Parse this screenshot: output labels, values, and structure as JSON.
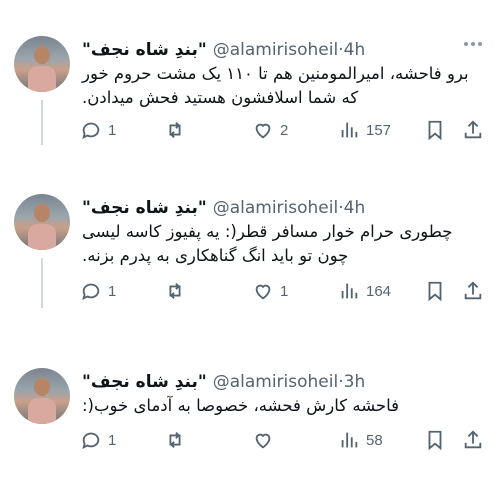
{
  "tweets": [
    {
      "display_name": "\"بندِ شاه نجف\"",
      "handle": "@alamirisoheil",
      "time": "4h",
      "lines": [
        "برو فاحشه، امیرالمومنین هم تا ۱۱۰ یک مشت حروم خور",
        "که شما اسلافشون هستید فحش میدادن."
      ],
      "replies": "1",
      "retweets": "",
      "likes": "2",
      "views": "157"
    },
    {
      "display_name": "\"بندِ شاه نجف\"",
      "handle": "@alamirisoheil",
      "time": "4h",
      "lines": [
        "چطوری حرام خوار مسافر قطر(: یه پفیوز کاسه لیسی",
        "چون تو باید انگ گناهکاری به پدرم بزنه."
      ],
      "replies": "1",
      "retweets": "",
      "likes": "1",
      "views": "164"
    },
    {
      "display_name": "\"بندِ شاه نجف\"",
      "handle": "@alamirisoheil",
      "time": "3h",
      "lines": [
        "فاحشه کارش فحشه، خصوصا به آدمای خوب(:"
      ],
      "replies": "1",
      "retweets": "",
      "likes": "",
      "views": "58"
    }
  ],
  "icons": [
    "reply-icon",
    "retweet-icon",
    "like-icon",
    "views-icon",
    "bookmark-icon",
    "share-icon",
    "more-icon"
  ]
}
